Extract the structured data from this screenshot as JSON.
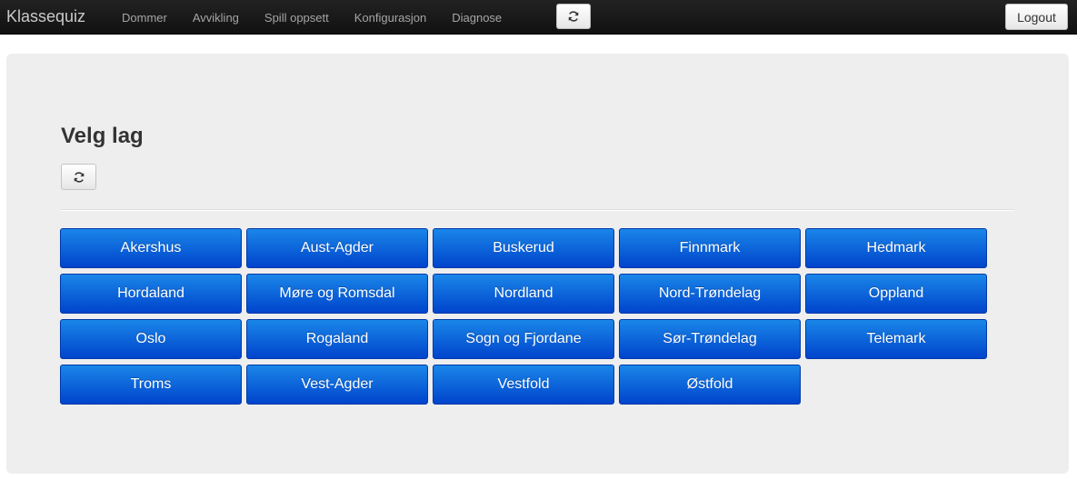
{
  "navbar": {
    "brand": "Klassequiz",
    "items": [
      {
        "label": "Dommer"
      },
      {
        "label": "Avvikling"
      },
      {
        "label": "Spill oppsett"
      },
      {
        "label": "Konfigurasjon"
      },
      {
        "label": "Diagnose"
      }
    ],
    "refresh_icon": "refresh-icon",
    "logout_label": "Logout"
  },
  "main": {
    "title": "Velg lag",
    "refresh_icon": "refresh-icon",
    "teams": [
      "Akershus",
      "Aust-Agder",
      "Buskerud",
      "Finnmark",
      "Hedmark",
      "Hordaland",
      "Møre og Romsdal",
      "Nordland",
      "Nord-Trøndelag",
      "Oppland",
      "Oslo",
      "Rogaland",
      "Sogn og Fjordane",
      "Sør-Trøndelag",
      "Telemark",
      "Troms",
      "Vest-Agder",
      "Vestfold",
      "Østfold"
    ]
  },
  "colors": {
    "navbar_bg": "#1b1b1b",
    "button_blue": "#0055dd",
    "panel_bg": "#eeeeee"
  }
}
